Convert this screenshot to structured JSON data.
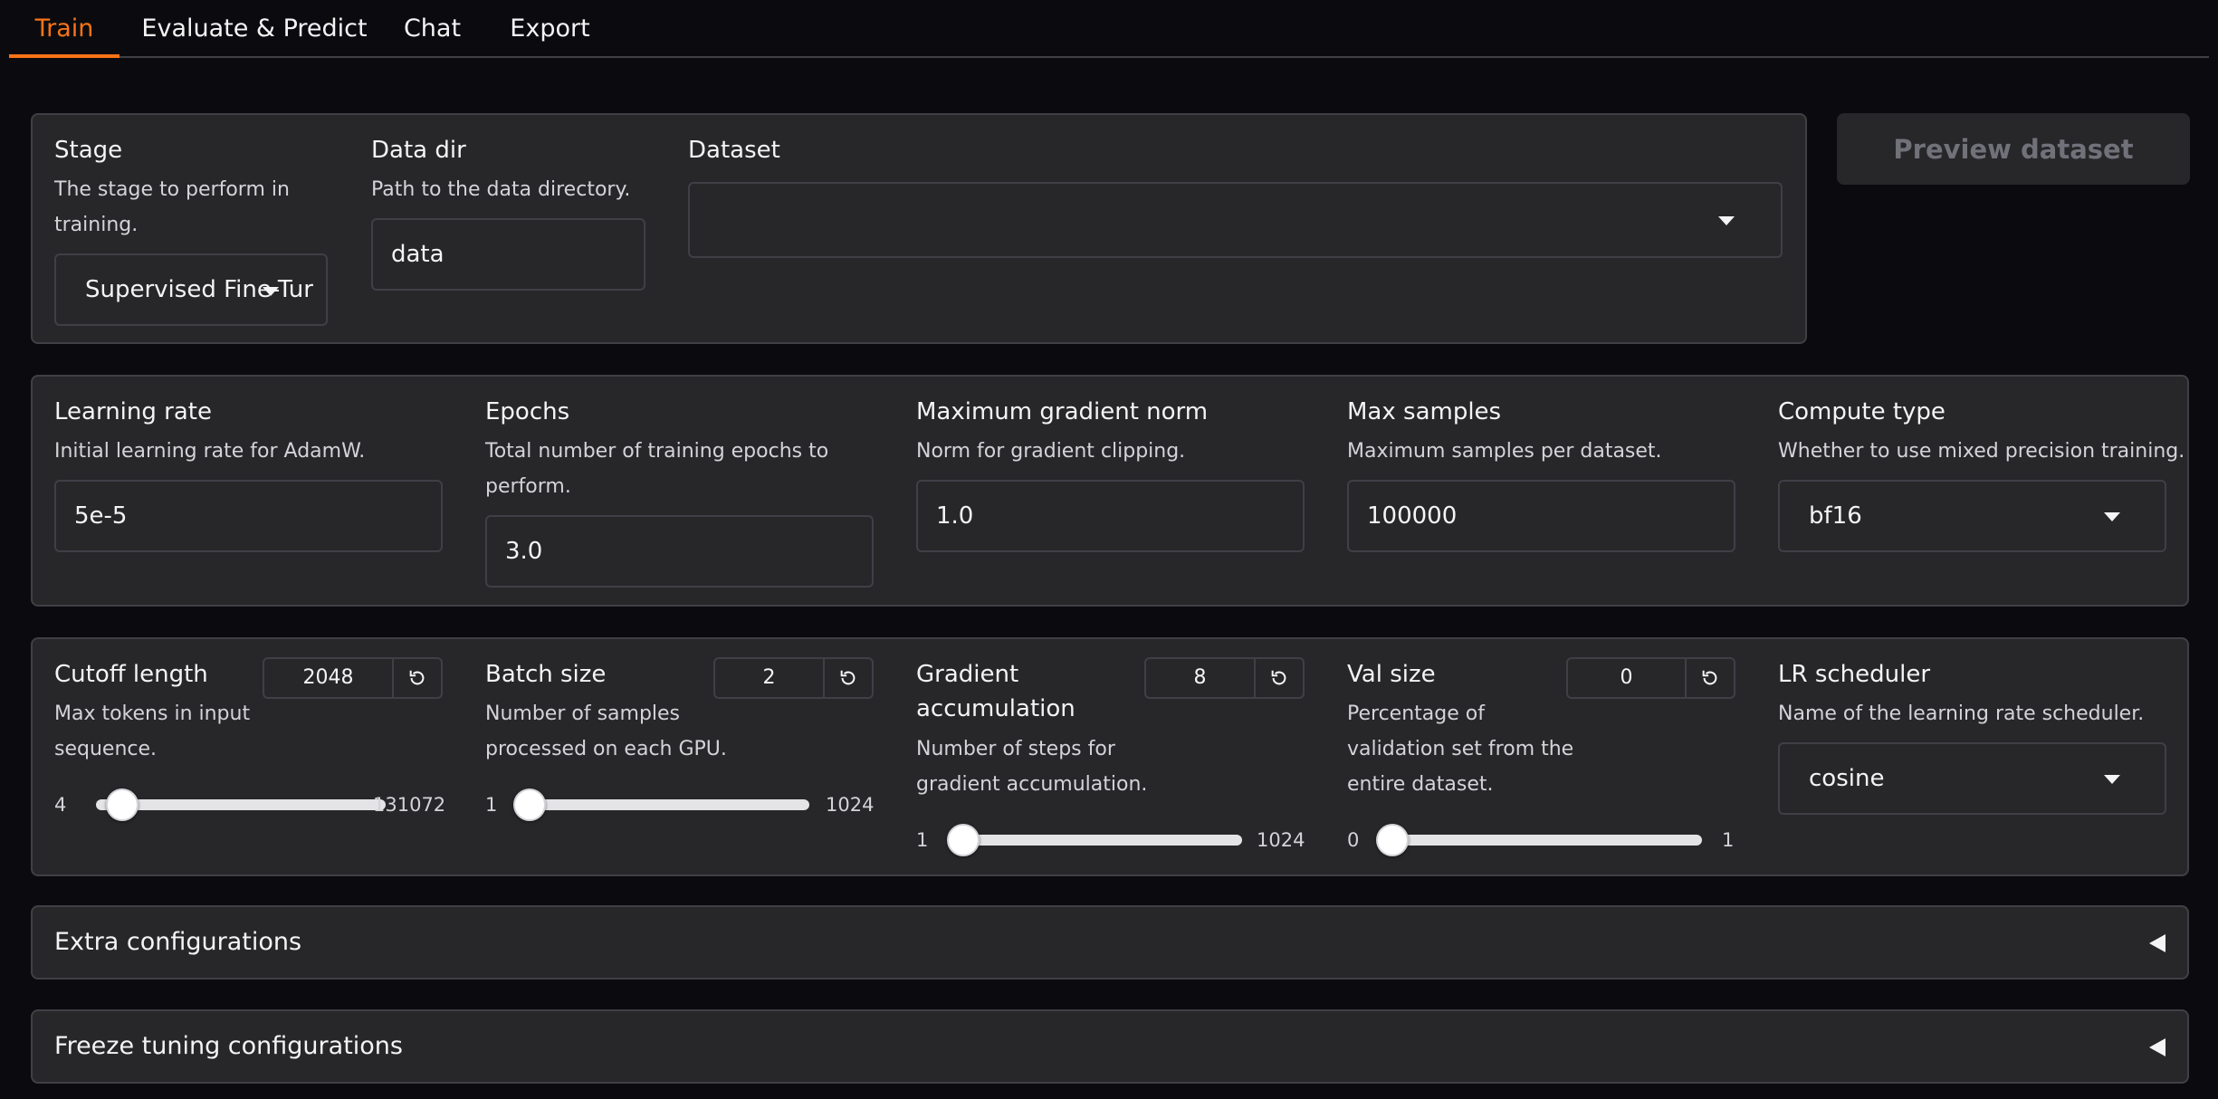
{
  "tabs": [
    {
      "label": "Train",
      "active": true
    },
    {
      "label": "Evaluate & Predict",
      "active": false
    },
    {
      "label": "Chat",
      "active": false
    },
    {
      "label": "Export",
      "active": false
    }
  ],
  "accent_color": "#f97316",
  "data_panel": {
    "stage": {
      "label": "Stage",
      "info": [
        "The stage to perform in",
        "training."
      ],
      "value": "Supervised Fine-Tur"
    },
    "data_dir": {
      "label": "Data dir",
      "info": "Path to the data directory.",
      "value": "data"
    },
    "dataset": {
      "label": "Dataset",
      "value": ""
    }
  },
  "preview_button": "Preview dataset",
  "hyper_panel": {
    "learning_rate": {
      "label": "Learning rate",
      "info": "Initial learning rate for AdamW.",
      "value": "5e-5"
    },
    "epochs": {
      "label": "Epochs",
      "info": [
        "Total number of training epochs to",
        "perform."
      ],
      "value": "3.0"
    },
    "max_grad_norm": {
      "label": "Maximum gradient norm",
      "info": "Norm for gradient clipping.",
      "value": "1.0"
    },
    "max_samples": {
      "label": "Max samples",
      "info": "Maximum samples per dataset.",
      "value": "100000"
    },
    "compute_type": {
      "label": "Compute type",
      "info": "Whether to use mixed precision training.",
      "value": "bf16"
    }
  },
  "slider_panel": {
    "cutoff_len": {
      "label": "Cutoff length",
      "info": [
        "Max tokens in input",
        "sequence."
      ],
      "value": "2048",
      "min": "4",
      "max": "131072",
      "fraction": 0.015
    },
    "batch_size": {
      "label": "Batch size",
      "info": [
        "Number of samples",
        "processed on each GPU."
      ],
      "value": "2",
      "min": "1",
      "max": "1024",
      "fraction": 0.001
    },
    "grad_accum": {
      "label": [
        "Gradient",
        "accumulation"
      ],
      "info": [
        "Number of steps for",
        "gradient accumulation."
      ],
      "value": "8",
      "min": "1",
      "max": "1024",
      "fraction": 0.007
    },
    "val_size": {
      "label": "Val size",
      "info": [
        "Percentage of",
        "validation set from the",
        "entire dataset."
      ],
      "value": "0",
      "min": "0",
      "max": "1",
      "fraction": 0.0
    },
    "lr_scheduler": {
      "label": "LR scheduler",
      "info": "Name of the learning rate scheduler.",
      "value": "cosine"
    }
  },
  "accordions": [
    {
      "label": "Extra configurations"
    },
    {
      "label": "Freeze tuning configurations"
    }
  ],
  "icons": {
    "reset": "reset-icon",
    "dropdown": "chevron-down-icon",
    "collapse": "triangle-left-icon"
  }
}
